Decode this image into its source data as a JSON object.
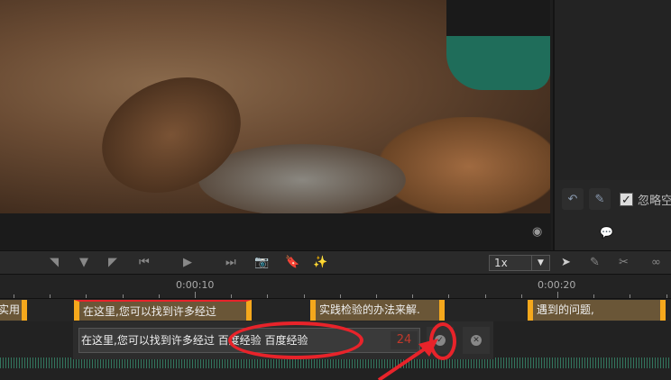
{
  "right_panel": {
    "ignore_label": "忽略空",
    "ignore_checked": true
  },
  "toolbar": {
    "speed": "1x"
  },
  "ruler": {
    "labels": [
      "0:00:10",
      "0:00:20"
    ]
  },
  "track": {
    "clips": [
      "实用",
      "在这里,您可以找到许多经过",
      "实践检验的办法来解.",
      "遇到的问题,"
    ]
  },
  "editor": {
    "value": "在这里,您可以找到许多经过  百度经验 百度经验",
    "char_count": "24"
  },
  "colors": {
    "clip_handle": "#f5a81c",
    "annotation": "#e8232a"
  }
}
